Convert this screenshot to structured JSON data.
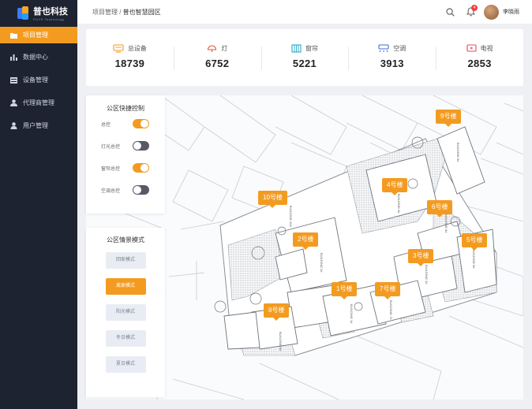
{
  "brand": {
    "name": "普也科技",
    "tagline": "PUYE Technology"
  },
  "nav": [
    {
      "label": "项目管理",
      "icon": "folder-icon",
      "active": true
    },
    {
      "label": "数据中心",
      "icon": "bar-chart-icon",
      "active": false
    },
    {
      "label": "设备管理",
      "icon": "list-icon",
      "active": false
    },
    {
      "label": "代理商管理",
      "icon": "users-icon",
      "active": false
    },
    {
      "label": "用户管理",
      "icon": "user-icon",
      "active": false
    }
  ],
  "breadcrumb": {
    "parent": "项目管理",
    "sep": " / ",
    "current": "普也智慧园区"
  },
  "header": {
    "notifications": "4",
    "username": "李晓雨"
  },
  "stats": [
    {
      "label": "总设备",
      "value": "18739",
      "icon": "device-icon"
    },
    {
      "label": "灯",
      "value": "6752",
      "icon": "lamp-icon"
    },
    {
      "label": "窗帘",
      "value": "5221",
      "icon": "curtain-icon"
    },
    {
      "label": "空调",
      "value": "3913",
      "icon": "ac-icon"
    },
    {
      "label": "电视",
      "value": "2853",
      "icon": "tv-icon"
    }
  ],
  "quick_control": {
    "title": "公区快捷控制",
    "switches": [
      {
        "label": "总控",
        "on": true
      },
      {
        "label": "灯光总控",
        "on": false
      },
      {
        "label": "窗帘总控",
        "on": true
      },
      {
        "label": "空调总控",
        "on": false
      }
    ]
  },
  "scene_mode": {
    "title": "公区情景模式",
    "modes": [
      {
        "label": "回家模式",
        "active": false
      },
      {
        "label": "离家模式",
        "active": true
      },
      {
        "label": "阳光模式",
        "active": false
      },
      {
        "label": "冬日模式",
        "active": false
      },
      {
        "label": "夏日模式",
        "active": false
      }
    ]
  },
  "buildings": [
    {
      "label": "9号楼"
    },
    {
      "label": "10号楼"
    },
    {
      "label": "4号楼"
    },
    {
      "label": "6号楼"
    },
    {
      "label": "2号楼"
    },
    {
      "label": "5号楼"
    },
    {
      "label": "3号楼"
    },
    {
      "label": "1号楼"
    },
    {
      "label": "7号楼"
    },
    {
      "label": "8号楼"
    }
  ],
  "colors": {
    "accent": "#f39b21",
    "sidebar": "#1d2330",
    "toggle_off": "#555a66"
  }
}
